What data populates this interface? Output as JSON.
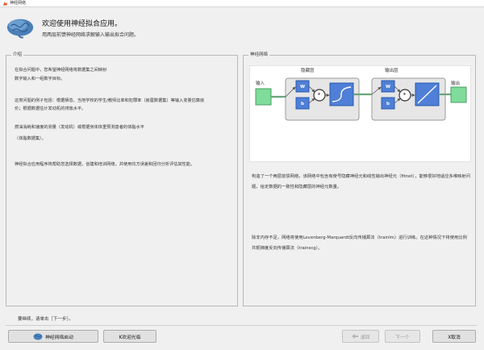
{
  "window": {
    "title": "神经网络",
    "icon": "matlab-icon"
  },
  "header": {
    "welcome": "欢迎使用神经拟合应用。",
    "subtitle": "用两层前馈神经网络求解输入输出拟合问题。",
    "icon": "brain-icon"
  },
  "intro": {
    "title": "介绍",
    "lines": [
      "在拟合问题中，您希望神经网络将数据集之间映射",
      "数字输入和一组数字目标。",
      "这类问题的例子包括：根据栖息、当地学校的学生/教师比率和犯罪率（房屋数据集）等输入变量估算房",
      "价；根据数据估计发动机的排放水平。",
      "燃油消耗和速度的测量（发动机）或根据身体体重预测患者的体脂水平",
      "（体脂数据集）。",
      "神经拟合应用程序将帮助您选择数据，创建和培训网络，并使用均方误差和回归分析评估其性能。"
    ]
  },
  "network": {
    "title": "神经网络",
    "diagram": {
      "input_label": "输入",
      "hidden_label": "隐藏层",
      "output_layer_label": "输出层",
      "output_label": "输出",
      "weight": "W",
      "bias": "b",
      "plus": "+"
    },
    "para1": "构造了一个两层前馈网络，该网络中包含有使号隐藏神经元和线性输出神经元（fitnet），能够很好地适应多维映射问题，给定数据的一致性和隐藏层的神经元数量。",
    "para2": "除非内存不足，网络将使用Levenberg-Marquardt反向传播算法（trainlm）进行训练。在这种情况下将使用比例共轭梯度反向传播算法（trainscg）。"
  },
  "footer": {
    "hint": "要继续，请单击［下一步］。",
    "buttons": {
      "nn_start": "神经网络启动",
      "welcome": "K欢迎光临",
      "back": "退回",
      "next": "下一个",
      "cancel": "X取消"
    }
  },
  "colors": {
    "input_block": "#7fdc9a",
    "layer_fill": "#e8e8e8",
    "node_fill": "#4f7fd6",
    "connector": "#5a8fe0"
  }
}
